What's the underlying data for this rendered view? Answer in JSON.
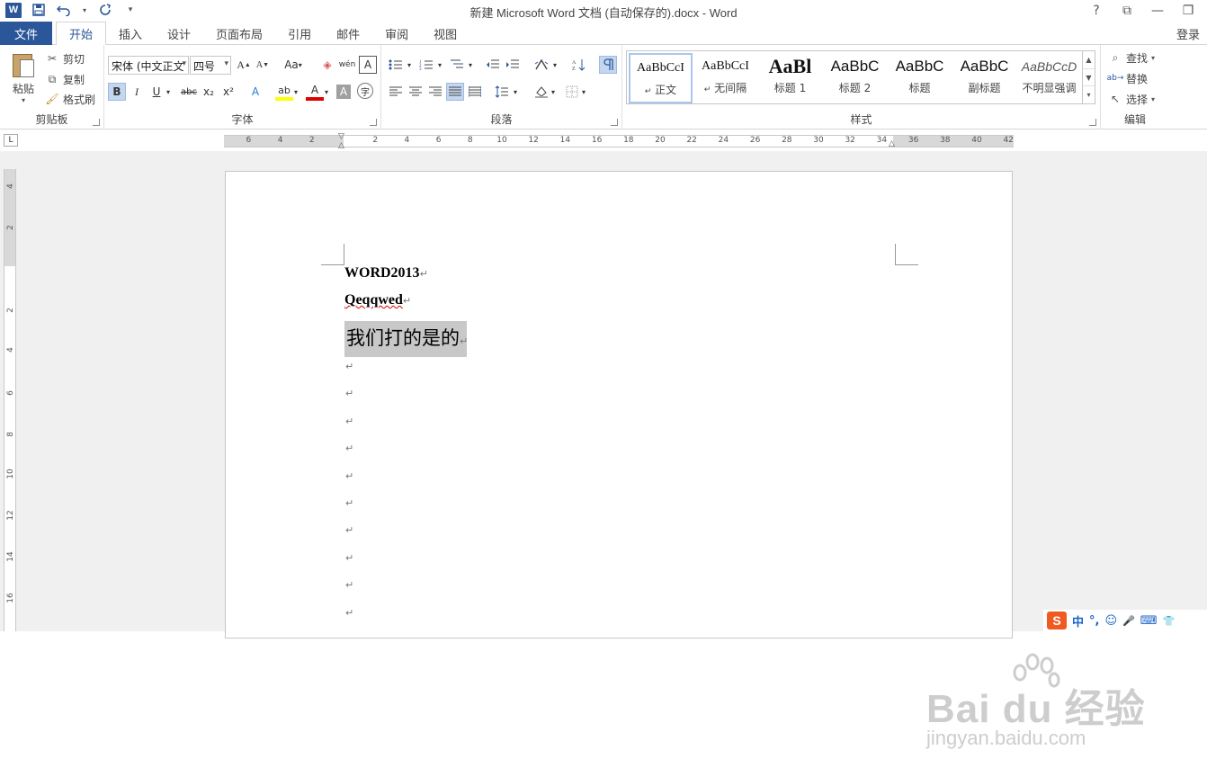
{
  "window": {
    "title": "新建 Microsoft Word 文档 (自动保存的).docx - Word",
    "logo": "W",
    "controls": [
      "?",
      "⧉",
      "—",
      "❐"
    ]
  },
  "qat": {
    "icons": [
      "save-icon",
      "undo-icon",
      "redo-icon",
      "customize-icon"
    ]
  },
  "tabs": {
    "file": "文件",
    "items": [
      "开始",
      "插入",
      "设计",
      "页面布局",
      "引用",
      "邮件",
      "审阅",
      "视图"
    ],
    "active_index": 0,
    "login": "登录"
  },
  "ribbon": {
    "clipboard": {
      "label": "剪贴板",
      "paste": "粘贴",
      "cut": "剪切",
      "copy": "复制",
      "format_painter": "格式刷"
    },
    "font": {
      "label": "字体",
      "font_name": "宋体 (中文正文",
      "font_size": "四号",
      "grow": "A",
      "shrink": "A",
      "change_case": "Aa",
      "pinyin": "wén",
      "border_char": "A",
      "bold": "B",
      "italic": "I",
      "underline": "U",
      "strike": "abc",
      "subscript": "x₂",
      "superscript": "x²",
      "text_effect": "A",
      "highlight": "ab",
      "font_color": "A",
      "char_shading": "A",
      "enclose": "字"
    },
    "paragraph": {
      "label": "段落"
    },
    "styles": {
      "label": "样式",
      "items": [
        {
          "sample": "AaBbCcI",
          "name": "正文",
          "prefix": "↵"
        },
        {
          "sample": "AaBbCcI",
          "name": "无间隔",
          "prefix": "↵"
        },
        {
          "sample": "AaBl",
          "name": "标题 1",
          "prefix": ""
        },
        {
          "sample": "AaBbC",
          "name": "标题 2",
          "prefix": ""
        },
        {
          "sample": "AaBbC",
          "name": "标题",
          "prefix": ""
        },
        {
          "sample": "AaBbC",
          "name": "副标题",
          "prefix": ""
        },
        {
          "sample": "AaBbCcD",
          "name": "不明显强调",
          "prefix": ""
        }
      ]
    },
    "editing": {
      "label": "编辑",
      "find": "查找",
      "replace": "替换",
      "select": "选择"
    }
  },
  "ruler": {
    "corner": "L",
    "h_numbers": [
      "6",
      "4",
      "2",
      "2",
      "4",
      "6",
      "8",
      "10",
      "12",
      "14",
      "16",
      "18",
      "20",
      "22",
      "24",
      "26",
      "28",
      "30",
      "32",
      "34",
      "36",
      "38",
      "40",
      "42"
    ],
    "v_numbers": [
      "4",
      "2",
      "2",
      "4",
      "6",
      "8",
      "10",
      "12",
      "14",
      "16"
    ]
  },
  "document": {
    "lines": [
      "WORD2013",
      "Qeqqwed",
      "我们打的是的"
    ],
    "paragraph_mark": "↵",
    "empty_line_count": 10
  },
  "watermark": {
    "text": "Bai du 经验",
    "sub": "jingyan.baidu.com"
  },
  "ime": {
    "logo": "S",
    "items": [
      "中",
      "°,",
      "☺",
      "🎤",
      "⌨",
      "👕"
    ]
  }
}
